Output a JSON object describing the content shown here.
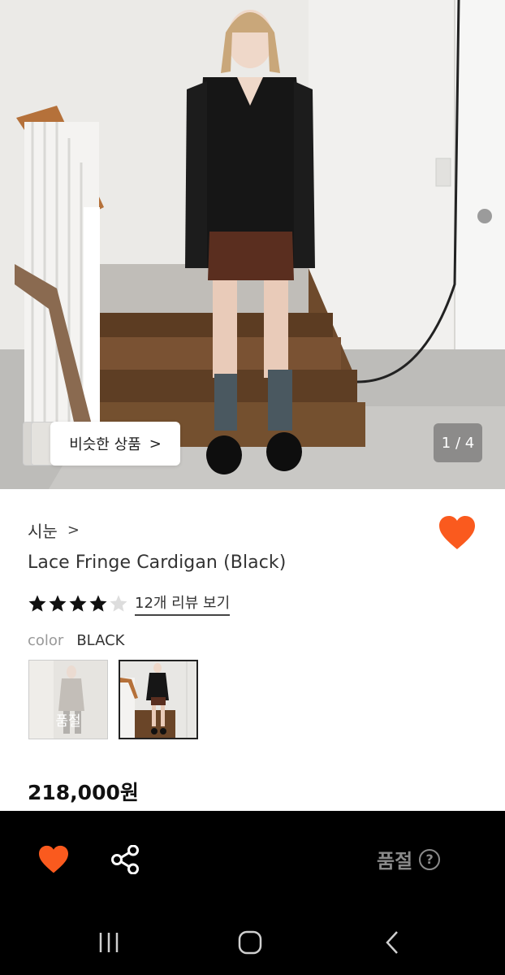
{
  "hero": {
    "similar_label": "비슷한 상품",
    "similar_chevron": ">",
    "page_indicator": "1 / 4"
  },
  "product": {
    "brand": "시눈",
    "brand_chevron": ">",
    "title": "Lace Fringe Cardigan (Black)",
    "rating": 4,
    "rating_max": 5,
    "review_link": "12개 리뷰 보기",
    "color_label": "color",
    "color_value": "BLACK",
    "swatches": [
      {
        "name": "grey",
        "sold_out_label": "품절"
      },
      {
        "name": "black",
        "selected": true
      }
    ],
    "price": "218,000원",
    "wishlisted": true
  },
  "action_bar": {
    "heart_icon": "heart-icon",
    "share_icon": "share-icon",
    "soldout_label": "품절",
    "help_icon": "?"
  },
  "colors": {
    "accent": "#fa5a1e",
    "bar": "#000000",
    "muted": "#8a8a8a"
  },
  "nav": {
    "recents_icon": "recent-apps-icon",
    "home_icon": "home-icon",
    "back_icon": "back-icon"
  }
}
